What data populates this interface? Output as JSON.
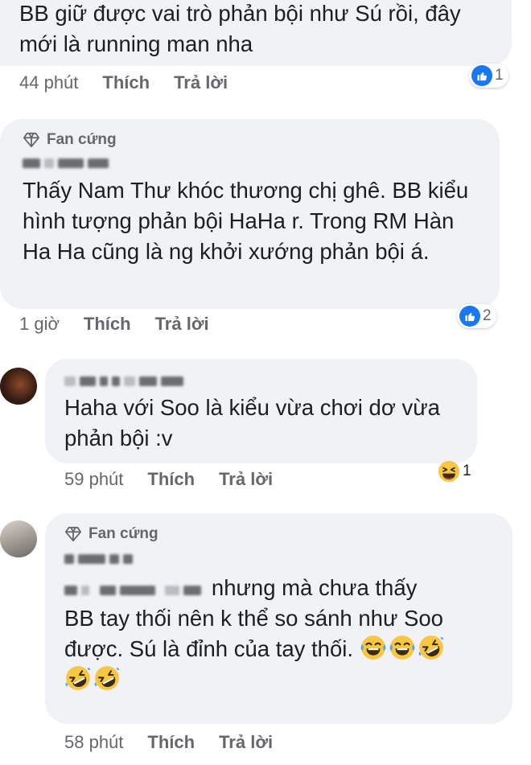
{
  "colors": {
    "bubble": "#f0f2f5",
    "meta": "#65676b",
    "like_blue": "#1877f2",
    "haha_yellow": "#f7c744"
  },
  "comments": [
    {
      "text": "BB giữ được vai trò phản bội như Sú rồi, đây mới là running man nha",
      "time": "44 phút",
      "like_label": "Thích",
      "reply_label": "Trả lời",
      "reaction": {
        "icon": "like-icon",
        "count": "1"
      }
    },
    {
      "badge": "Fan cứng",
      "text": "Thấy Nam Thư khóc thương chị ghê. BB kiểu hình tượng phản bội HaHa r. Trong RM Hàn Ha Ha cũng là ng khởi xướng phản bội á.",
      "time": "1 giờ",
      "like_label": "Thích",
      "reply_label": "Trả lời",
      "reaction": {
        "icon": "like-icon",
        "count": "2"
      }
    },
    {
      "text": "Haha với Soo là kiểu vừa chơi dơ vừa phản bội :v",
      "time": "59 phút",
      "like_label": "Thích",
      "reply_label": "Trả lời",
      "reaction": {
        "icon": "haha-icon",
        "count": "1"
      }
    },
    {
      "badge": "Fan cứng",
      "text_line1": "nhưng mà chưa thấy",
      "text_line2": "BB tay thối nên k thể so sánh như Soo",
      "text_line3": "được. Sú là đỉnh của tay thối.",
      "emojis": [
        "rolling-laugh-icon",
        "rolling-laugh-icon",
        "rofl-icon",
        "rofl-icon",
        "rofl-icon"
      ],
      "time": "58 phút",
      "like_label": "Thích",
      "reply_label": "Trả lời"
    }
  ]
}
